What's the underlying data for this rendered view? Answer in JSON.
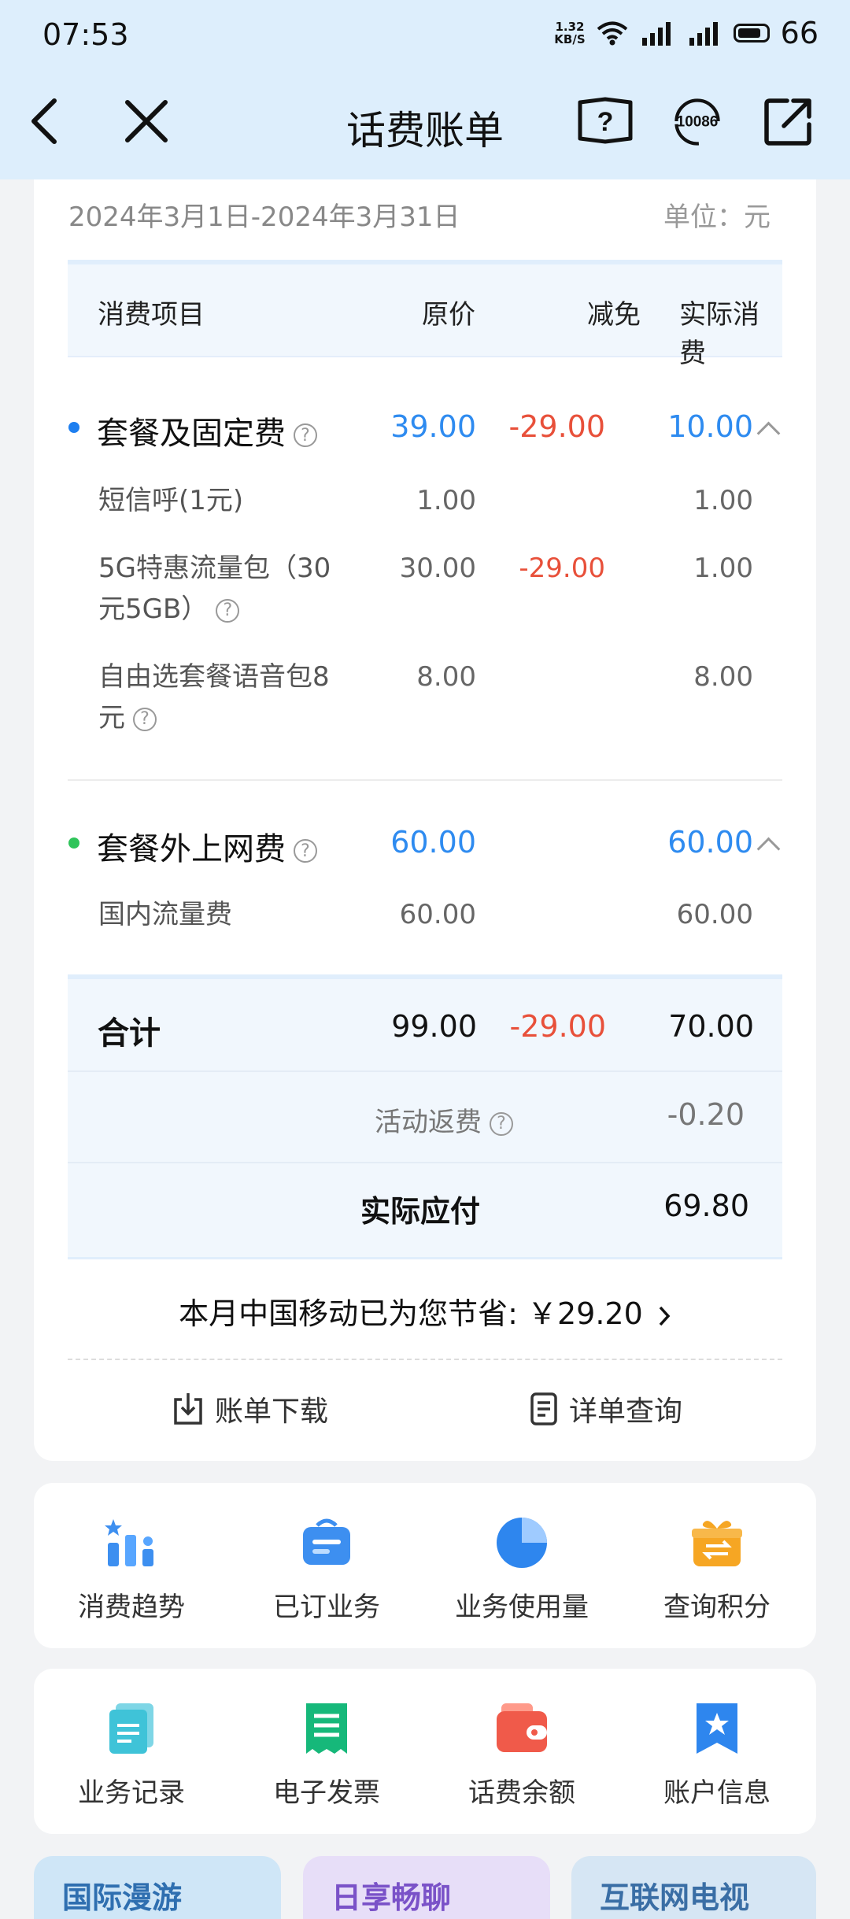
{
  "status_bar": {
    "time": "07:53",
    "net_speed_value": "1.32",
    "net_speed_unit": "KB/S",
    "battery": "66"
  },
  "header": {
    "title": "话费账单",
    "icons": [
      "back-icon",
      "close-icon",
      "help-book-icon",
      "customer-service-10086-icon",
      "share-icon"
    ],
    "service_label": "10086"
  },
  "bill": {
    "period": "2024年3月1日-2024年3月31日",
    "unit": "单位：元",
    "columns": {
      "item": "消费项目",
      "original": "原价",
      "discount": "减免",
      "actual": "实际消费"
    },
    "sections": [
      {
        "title": "套餐及固定费",
        "dot_color": "#1e7ff0",
        "original": "39.00",
        "discount": "-29.00",
        "actual": "10.00",
        "items": [
          {
            "label": "短信呼(1元)",
            "original": "1.00",
            "discount": "",
            "actual": "1.00"
          },
          {
            "label": "5G特惠流量包（30元5GB）",
            "original": "30.00",
            "discount": "-29.00",
            "actual": "1.00"
          },
          {
            "label": "自由选套餐语音包8元",
            "original": "8.00",
            "discount": "",
            "actual": "8.00"
          }
        ]
      },
      {
        "title": "套餐外上网费",
        "dot_color": "#2fc45a",
        "original": "60.00",
        "discount": "",
        "actual": "60.00",
        "items": [
          {
            "label": "国内流量费",
            "original": "60.00",
            "discount": "",
            "actual": "60.00"
          }
        ]
      }
    ],
    "total": {
      "label": "合计",
      "original": "99.00",
      "discount": "-29.00",
      "actual": "70.00"
    },
    "rebate": {
      "label": "活动返费",
      "value": "-0.20"
    },
    "payable": {
      "label": "实际应付",
      "value": "69.80"
    },
    "savings_text": "本月中国移动已为您节省: ￥29.20",
    "actions": {
      "download": "账单下载",
      "detail": "详单查询"
    }
  },
  "grid1": [
    {
      "label": "消费趋势",
      "icon": "consumption-trend-icon"
    },
    {
      "label": "已订业务",
      "icon": "subscribed-services-icon"
    },
    {
      "label": "业务使用量",
      "icon": "usage-pie-icon"
    },
    {
      "label": "查询积分",
      "icon": "points-gift-icon"
    }
  ],
  "grid2": [
    {
      "label": "业务记录",
      "icon": "service-records-icon"
    },
    {
      "label": "电子发票",
      "icon": "e-invoice-icon"
    },
    {
      "label": "话费余额",
      "icon": "balance-wallet-icon"
    },
    {
      "label": "账户信息",
      "icon": "account-info-icon"
    }
  ],
  "promos": [
    "国际漫游",
    "日享畅聊",
    "互联网电视"
  ],
  "colors": {
    "accent_blue": "#2e8bf0",
    "discount_red": "#e8503a",
    "header_bg": "#ddeefc"
  }
}
